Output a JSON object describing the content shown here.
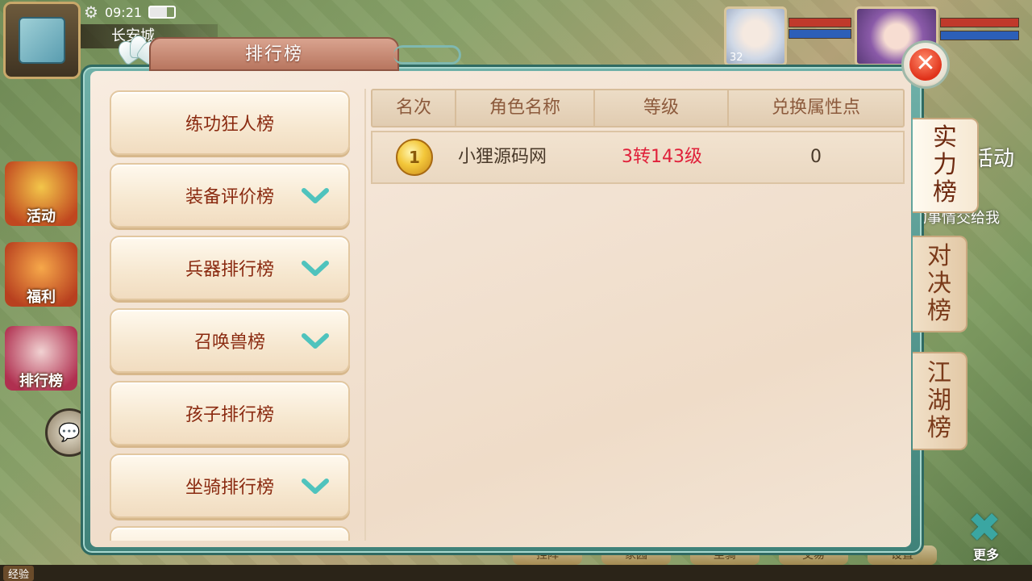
{
  "hud": {
    "time": "09:21",
    "city": "长安城",
    "portrait_level": "32",
    "side_menu": [
      {
        "label": "活动"
      },
      {
        "label": "福利"
      },
      {
        "label": "排行榜"
      }
    ],
    "right_bg_texts": [
      "活动",
      "的事情交给我"
    ],
    "exp_label": "经验",
    "bottom_menu": [
      "挂阵",
      "家园",
      "坐骑",
      "交易",
      "设置"
    ],
    "more_label": "更多"
  },
  "panel": {
    "title": "排行榜",
    "categories": [
      {
        "label": "练功狂人榜",
        "expandable": false
      },
      {
        "label": "装备评价榜",
        "expandable": true
      },
      {
        "label": "兵器排行榜",
        "expandable": true
      },
      {
        "label": "召唤兽榜",
        "expandable": true
      },
      {
        "label": "孩子排行榜",
        "expandable": false
      },
      {
        "label": "坐骑排行榜",
        "expandable": true
      }
    ],
    "table": {
      "headers": [
        "名次",
        "角色名称",
        "等级",
        "兑换属性点"
      ],
      "rows": [
        {
          "rank": "1",
          "name": "小狸源码网",
          "level": "3转143级",
          "points": "0"
        }
      ]
    },
    "tabs": [
      {
        "label": [
          "实",
          "力",
          "榜"
        ],
        "active": true
      },
      {
        "label": [
          "对",
          "决",
          "榜"
        ],
        "active": false
      },
      {
        "label": [
          "江",
          "湖",
          "榜"
        ],
        "active": false
      }
    ]
  },
  "colors": {
    "accent_red": "#e0203a",
    "text_brown": "#8a2a10",
    "chevron_teal": "#4fc3bd"
  }
}
